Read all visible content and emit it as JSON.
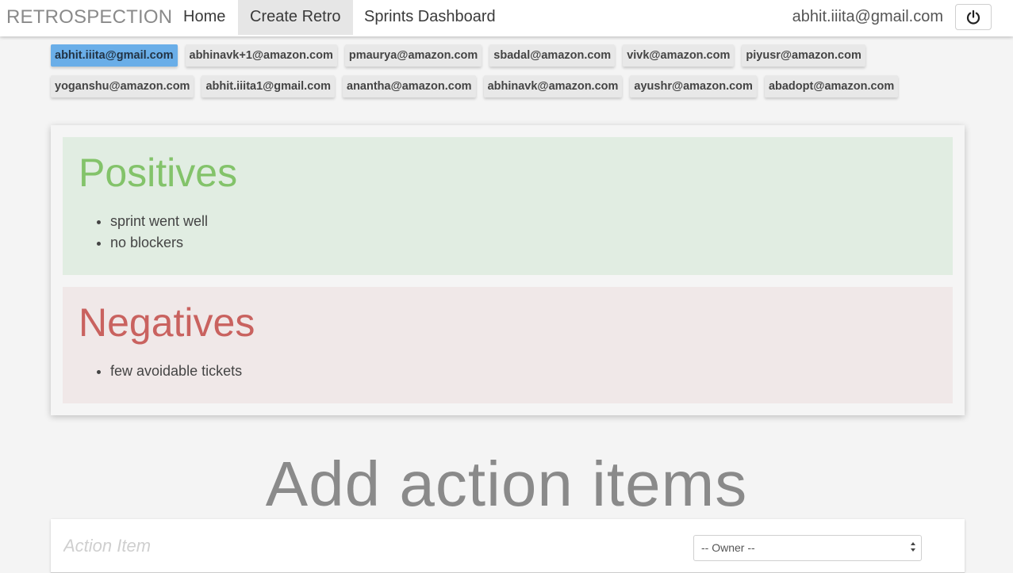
{
  "navbar": {
    "brand": "RETROSPECTION",
    "links": [
      "Home",
      "Create Retro",
      "Sprints Dashboard"
    ],
    "active_link": "Create Retro",
    "user_email": "abhit.iiita@gmail.com",
    "power_icon": "power-icon"
  },
  "participants": {
    "row1": [
      "abhit.iiita@gmail.com",
      "abhinavk+1@amazon.com",
      "pmaurya@amazon.com",
      "sbadal@amazon.com",
      "vivk@amazon.com",
      "piyusr@amazon.com"
    ],
    "row2": [
      "yoganshu@amazon.com",
      "abhit.iiita1@gmail.com",
      "anantha@amazon.com",
      "abhinavk@amazon.com",
      "ayushr@amazon.com",
      "abadopt@amazon.com"
    ],
    "selected": "abhit.iiita@gmail.com"
  },
  "retro": {
    "positives": {
      "title": "Positives",
      "items": [
        "sprint went well",
        "no blockers"
      ]
    },
    "negatives": {
      "title": "Negatives",
      "items": [
        "few avoidable tickets"
      ]
    }
  },
  "action_items": {
    "heading": "Add action items",
    "input_placeholder": "Action Item",
    "owner_select": "-- Owner --"
  },
  "colors": {
    "positive_text": "#83c36a",
    "negative_text": "#c9625f",
    "selected_chip": "#6aaee8"
  }
}
